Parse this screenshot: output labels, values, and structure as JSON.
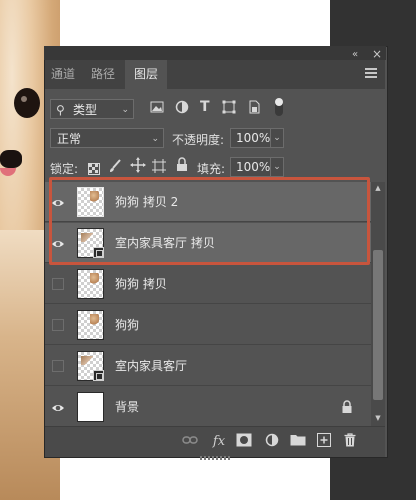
{
  "panel": {
    "tabs": [
      {
        "label": "通道",
        "active": false
      },
      {
        "label": "路径",
        "active": false
      },
      {
        "label": "图层",
        "active": true
      }
    ]
  },
  "filter": {
    "kind_label": "类型"
  },
  "blend": {
    "mode": "正常",
    "opacity_label": "不透明度:",
    "opacity_value": "100%"
  },
  "lock": {
    "label": "锁定:",
    "fill_label": "填充:",
    "fill_value": "100%"
  },
  "layers": [
    {
      "name": "狗狗 拷贝 2",
      "visible": true,
      "selected": true
    },
    {
      "name": "室内家具客厅 拷贝",
      "visible": true,
      "selected": true
    },
    {
      "name": "狗狗 拷贝",
      "visible": false,
      "selected": false
    },
    {
      "name": "狗狗",
      "visible": false,
      "selected": false
    },
    {
      "name": "室内家具客厅",
      "visible": false,
      "selected": false
    },
    {
      "name": "背景",
      "visible": true,
      "selected": false,
      "locked": true
    }
  ],
  "colors": {
    "panel_bg": "#535353",
    "selected_row": "#676767",
    "highlight_frame": "#c8553d"
  },
  "icons": {
    "bottom_bar": [
      "link-layers-icon",
      "fx-icon",
      "layer-mask-icon",
      "adjustment-layer-icon",
      "new-group-icon",
      "new-layer-icon",
      "delete-layer-icon"
    ]
  }
}
